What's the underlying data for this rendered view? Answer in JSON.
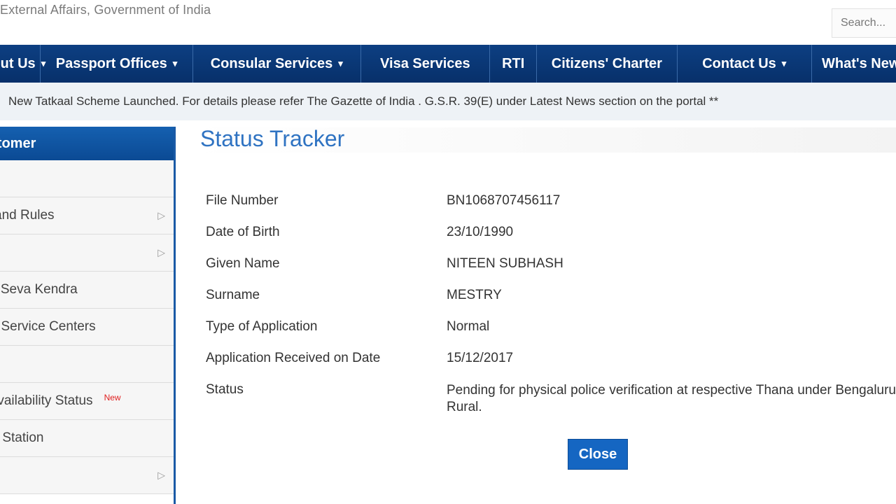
{
  "header": {
    "org_text": "External Affairs, Government of India",
    "search_placeholder": "Search..."
  },
  "nav": {
    "items": [
      {
        "label": "About Us",
        "caret": "▾"
      },
      {
        "label": "Passport Offices",
        "caret": "▾"
      },
      {
        "label": "Consular Services",
        "caret": "▾"
      },
      {
        "label": "Visa Services"
      },
      {
        "label": "RTI"
      },
      {
        "label": "Citizens' Charter"
      },
      {
        "label": "Contact Us",
        "caret": "▾"
      },
      {
        "label": "What's New"
      }
    ]
  },
  "ticker": {
    "text": "New Tatkaal Scheme Launched. For details please refer The Gazette of India . G.S.R. 39(E) under Latest News section on the portal ** "
  },
  "sidebar": {
    "heading": "Customer",
    "items": [
      {
        "label": ""
      },
      {
        "label": "and Rules",
        "arrow": "▷"
      },
      {
        "label": "",
        "arrow": "▷"
      },
      {
        "label": "rt Seva Kendra"
      },
      {
        "label": "ort Service Centers"
      },
      {
        "label": ""
      },
      {
        "label": "Availability Status",
        "badge": "New"
      },
      {
        "label": "ce Station"
      },
      {
        "label": "",
        "arrow": "▷"
      }
    ]
  },
  "main": {
    "title": "Status Tracker",
    "fields": [
      {
        "label": "File Number",
        "value": "BN1068707456117"
      },
      {
        "label": "Date of Birth",
        "value": "23/10/1990"
      },
      {
        "label": "Given Name",
        "value": "NITEEN SUBHASH"
      },
      {
        "label": "Surname",
        "value": "MESTRY"
      },
      {
        "label": "Type of Application",
        "value": "Normal"
      },
      {
        "label": "Application Received on Date",
        "value": "15/12/2017"
      },
      {
        "label": "Status",
        "value": "Pending for physical police verification at respective Thana under Bengaluru Rural."
      }
    ],
    "close_label": "Close"
  }
}
